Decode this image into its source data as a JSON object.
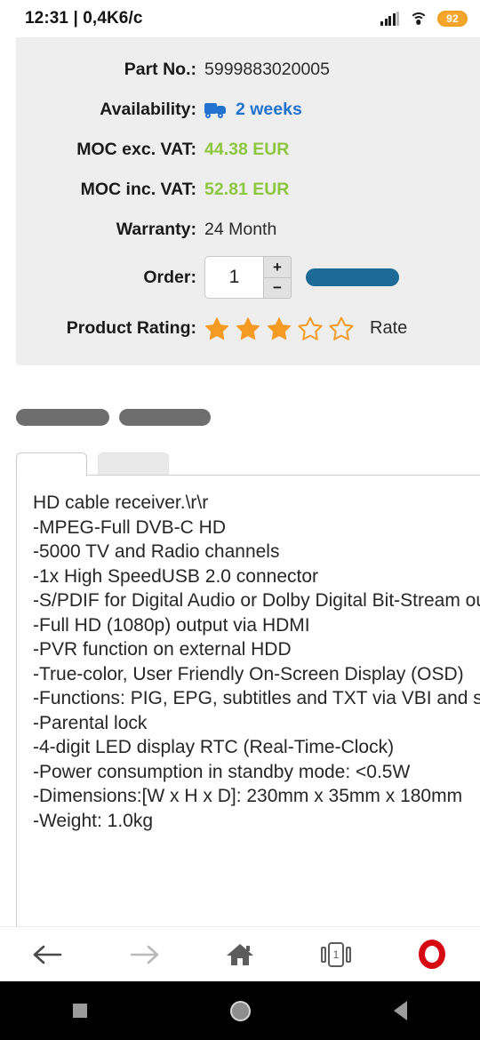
{
  "status_bar": {
    "left_text": "12:31 | 0,4K6/c",
    "battery_level": "92",
    "signal_icon": "signal-bars-icon",
    "wifi_icon": "wifi-icon"
  },
  "product": {
    "rows": [
      {
        "label": "Part No.:",
        "value": "5999883020005",
        "style": "plain"
      },
      {
        "label": "Availability:",
        "value": "2 weeks",
        "style": "blue",
        "icon": "delivery-truck-icon"
      },
      {
        "label": "MOC exc. VAT:",
        "value": "44.38 EUR",
        "style": "green"
      },
      {
        "label": "MOC inc. VAT:",
        "value": "52.81 EUR",
        "style": "green"
      },
      {
        "label": "Warranty:",
        "value": "24 Month",
        "style": "plain"
      }
    ],
    "order": {
      "label": "Order:",
      "quantity": "1",
      "spinner_up": "+",
      "spinner_down": "−",
      "add_to_cart_color": "#1d6a96"
    },
    "rating": {
      "label": "Product Rating:",
      "filled_stars": 3,
      "total_stars": 5,
      "star_color": "#f59a23",
      "rate_text": "Rate"
    }
  },
  "tabs": {
    "active_label": "",
    "inactive_label": ""
  },
  "description": {
    "text": "HD cable receiver.\\r\\r\n-MPEG-Full DVB-C HD\n-5000 TV and Radio channels\n-1x High SpeedUSB 2.0 connector\n-S/PDIF for Digital Audio or Dolby Digital Bit-Stream output\n-Full HD (1080p) output via HDMI\n-PVR function on external HDD\n-True-color, User Friendly On-Screen Display (OSD)\n-Functions: PIG, EPG, subtitles and TXT via VBI and sw support\n-Parental lock\n-4-digit LED display RTC (Real-Time-Clock)\n-Power consumption in standby mode: <0.5W\n-Dimensions:[W x H x D]: 230mm x 35mm x 180mm\n-Weight: 1.0kg"
  },
  "browser_bar": {
    "back_icon": "arrow-left-icon",
    "forward_icon": "arrow-right-icon",
    "home_icon": "home-icon",
    "tabs_icon": "tab-switcher-icon",
    "tab_count": "1",
    "menu_icon": "opera-logo-icon",
    "brand_color": "#d70a14"
  },
  "android_nav": {
    "recents_icon": "square-recents-icon",
    "home_icon": "circle-home-icon",
    "back_icon": "triangle-back-icon"
  }
}
